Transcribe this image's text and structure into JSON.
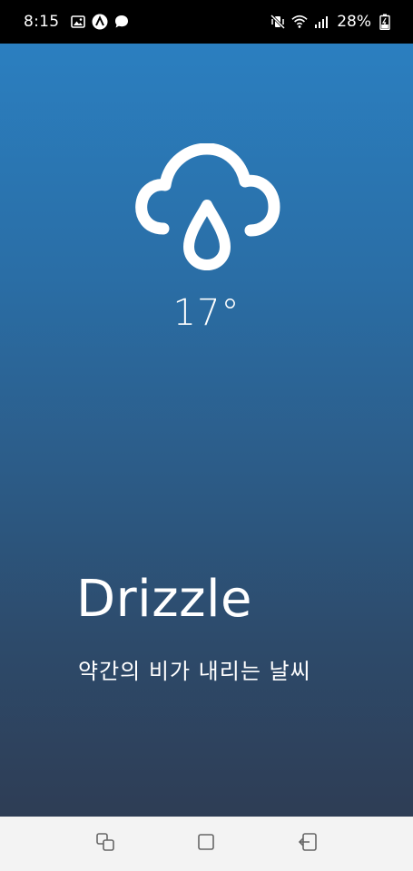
{
  "status_bar": {
    "time": "8:15",
    "battery_percent": "28%",
    "left_icons": [
      "gallery-icon",
      "arrow-app-icon",
      "chat-bubble-icon"
    ],
    "right_icons": [
      "vibrate-mute-icon",
      "wifi-icon",
      "signal-icon",
      "battery-charging-icon"
    ]
  },
  "weather": {
    "icon": "rain-cloud-icon",
    "temperature": "17°",
    "condition": "Drizzle",
    "description": "약간의 비가 내리는 날씨"
  },
  "colors": {
    "gradient_top": "#2b7fc0",
    "gradient_bottom": "#2e3d55",
    "nav_background": "#f3f3f3",
    "text": "#ffffff"
  },
  "nav_bar": {
    "buttons": [
      "recent-apps-icon",
      "home-icon",
      "back-icon"
    ]
  }
}
